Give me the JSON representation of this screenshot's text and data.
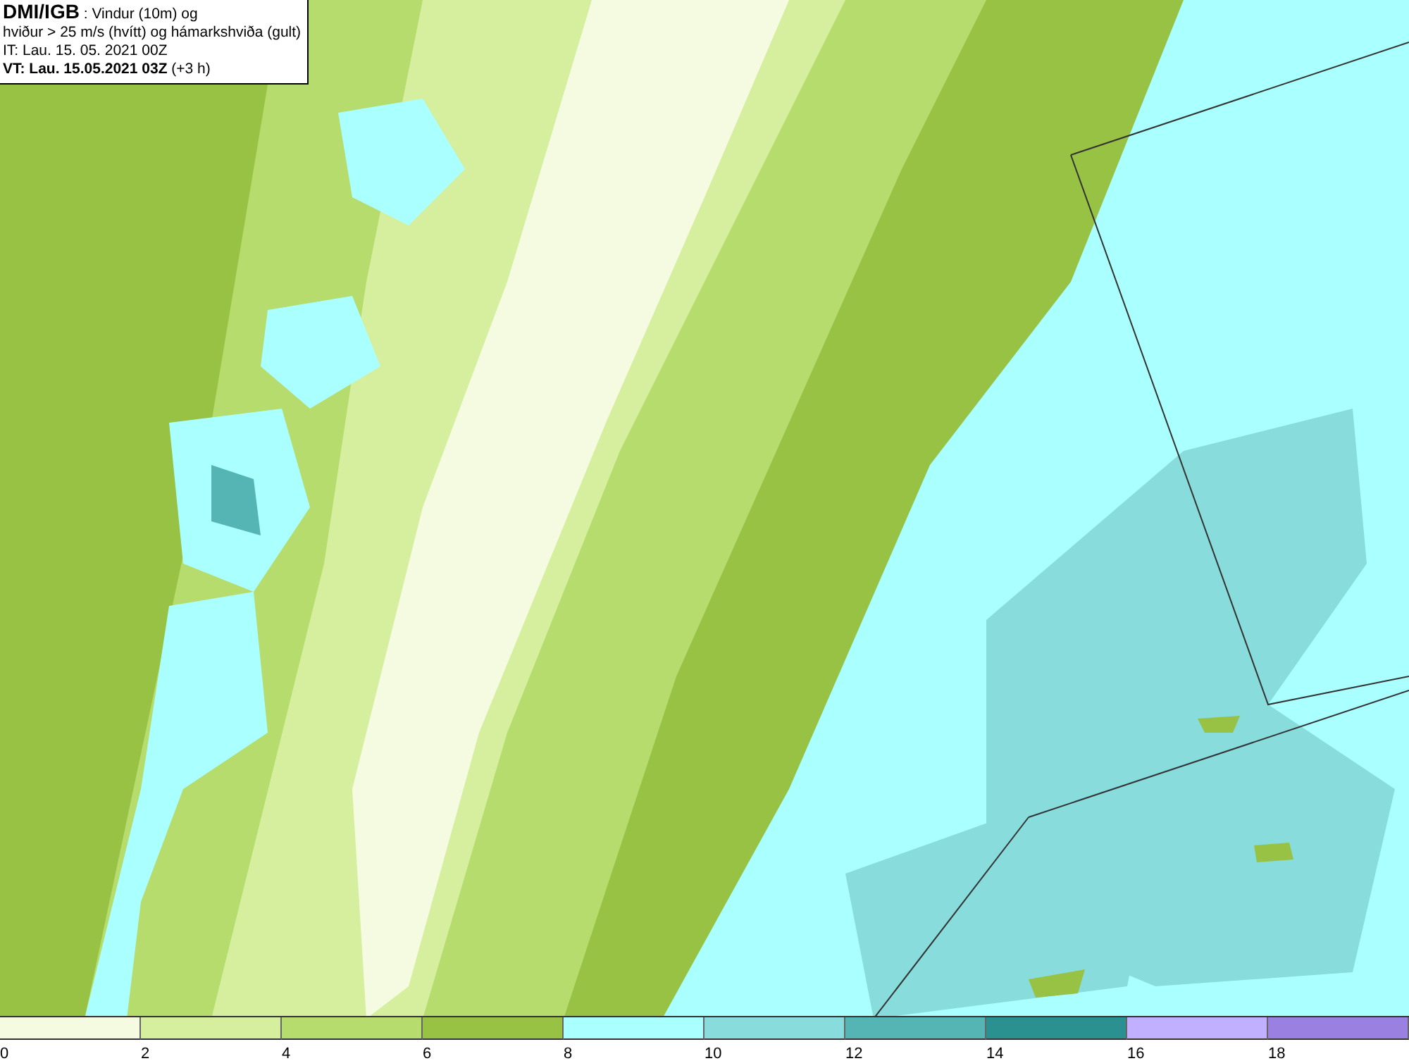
{
  "title_box": {
    "lines": [
      "**DMI/IGB** : Vindur (10m) og",
      "hviður > 25 m/s (hvítt) og hámarkshviða (gult)",
      "IT: Lau. 15. 05. 2021 00Z",
      "**VT: Lau. 15.05.2021 03Z** (+3 h)"
    ]
  },
  "legend": {
    "bins": [
      {
        "color": "#f4fbe1",
        "tick": "0"
      },
      {
        "color": "#d5ef9e",
        "tick": "2"
      },
      {
        "color": "#b5dc6c",
        "tick": "4"
      },
      {
        "color": "#97c244",
        "tick": "6"
      },
      {
        "color": "#aaffff",
        "tick": "8"
      },
      {
        "color": "#88dcdc",
        "tick": "10"
      },
      {
        "color": "#55b5b5",
        "tick": "12"
      },
      {
        "color": "#2a9090",
        "tick": "14"
      },
      {
        "color": "#c0b0ff",
        "tick": "16"
      },
      {
        "color": "#9a80e0",
        "tick": "18"
      }
    ]
  }
}
